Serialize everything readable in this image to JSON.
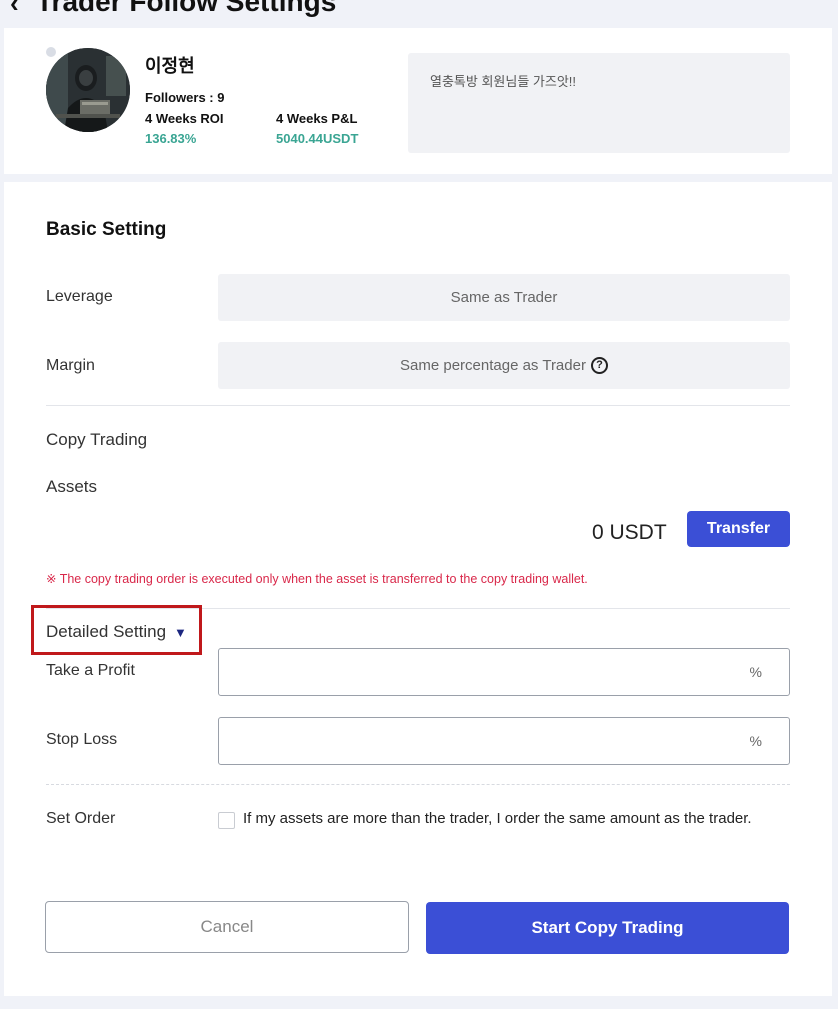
{
  "header": {
    "back_icon": "‹",
    "title": "Trader Follow Settings"
  },
  "profile": {
    "name": "이정현",
    "followers": "Followers : 9",
    "roi_label": "4 Weeks ROI",
    "roi_value": "136.83%",
    "pnl_label": "4 Weeks P&L",
    "pnl_value": "5040.44USDT",
    "bio": "열충톡방 회원님들 가즈앗!!",
    "accent_color": "#3aa593"
  },
  "basic": {
    "title": "Basic Setting",
    "leverage_label": "Leverage",
    "leverage_value": "Same as Trader",
    "margin_label": "Margin",
    "margin_value": "Same percentage as Trader",
    "margin_help_icon": "?"
  },
  "copy": {
    "title": "Copy Trading",
    "assets_label": "Assets",
    "balance": "0 USDT",
    "transfer_label": "Transfer",
    "warning": "※ The copy trading order is executed only when the asset is transferred to the copy trading wallet."
  },
  "detailed": {
    "title": "Detailed Setting",
    "caret_icon": "▼",
    "take_profit_label": "Take a Profit",
    "take_profit_value": "",
    "take_profit_unit": "%",
    "stop_loss_label": "Stop Loss",
    "stop_loss_value": "",
    "stop_loss_unit": "%",
    "set_order_label": "Set Order",
    "set_order_text": "If my assets are more than the trader, I order the same amount as the trader."
  },
  "actions": {
    "cancel_label": "Cancel",
    "start_label": "Start Copy Trading",
    "primary_color": "#3b4fd6"
  }
}
